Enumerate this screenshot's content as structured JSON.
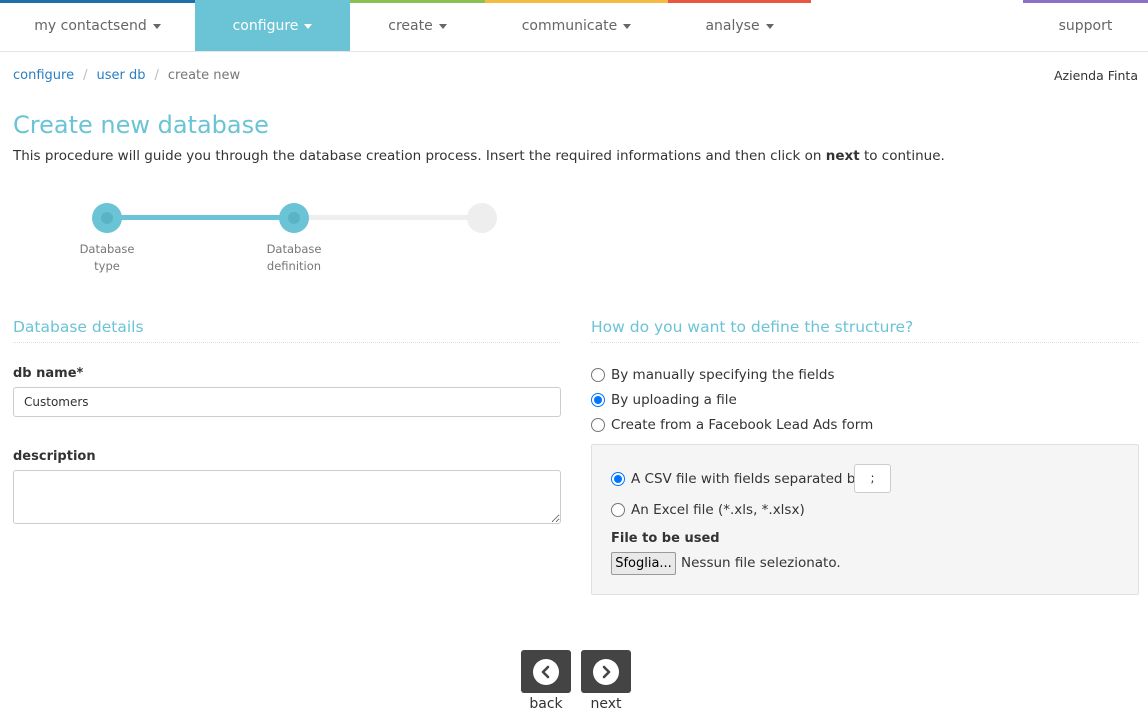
{
  "nav": {
    "items": [
      {
        "label": "my contactsend",
        "color": "#1f6fa8"
      },
      {
        "label": "configure",
        "color": "#6bc4d5"
      },
      {
        "label": "create",
        "color": "#8cc152"
      },
      {
        "label": "communicate",
        "color": "#f6bb42"
      },
      {
        "label": "analyse",
        "color": "#e9573f"
      }
    ],
    "support": {
      "label": "support",
      "color": "#8e6fc8"
    }
  },
  "breadcrumb": {
    "items": [
      "configure",
      "user db"
    ],
    "current": "create new"
  },
  "company": "Azienda Finta",
  "page": {
    "title": "Create new database",
    "intro_before": "This procedure will guide you through the database creation process. Insert the required informations and then click on ",
    "intro_bold": "next",
    "intro_after": " to continue."
  },
  "stepper": {
    "steps": [
      {
        "line1": "Database",
        "line2": "type",
        "done": true
      },
      {
        "line1": "Database",
        "line2": "definition",
        "done": true
      },
      {
        "line1": "",
        "line2": "",
        "done": false
      }
    ]
  },
  "details": {
    "title": "Database details",
    "db_name_label": "db name*",
    "db_name_value": "Customers",
    "description_label": "description",
    "description_value": ""
  },
  "structure": {
    "title": "How do you want to define the structure?",
    "options": [
      {
        "label": "By manually specifying the fields",
        "checked": false
      },
      {
        "label": "By uploading a file",
        "checked": true
      },
      {
        "label": "Create from a Facebook Lead Ads form",
        "checked": false
      }
    ],
    "file_types": [
      {
        "label": "A CSV file with fields separated by",
        "checked": true
      },
      {
        "label": "An Excel file (*.xls, *.xlsx)",
        "checked": false
      }
    ],
    "separator": ";",
    "file_label": "File to be used",
    "browse_label": "Sfoglia...",
    "no_file_text": "Nessun file selezionato."
  },
  "footer": {
    "back_label": "back",
    "next_label": "next"
  }
}
